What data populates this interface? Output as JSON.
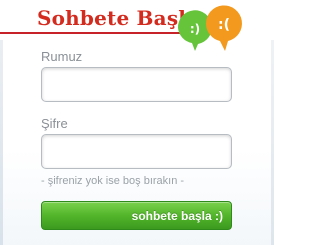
{
  "header": {
    "title": "Sohbete Başla",
    "accent_color": "#d42b1f",
    "icon": "smiley-speech-bubbles-icon",
    "green_face": ":)",
    "orange_face": ":("
  },
  "form": {
    "username_label": "Rumuz",
    "username_value": "",
    "password_label": "Şifre",
    "password_value": "",
    "hint": "- şifreniz yok ise boş bırakın -",
    "submit_label": "sohbete başla :)",
    "submit_color": "#52b52a"
  }
}
